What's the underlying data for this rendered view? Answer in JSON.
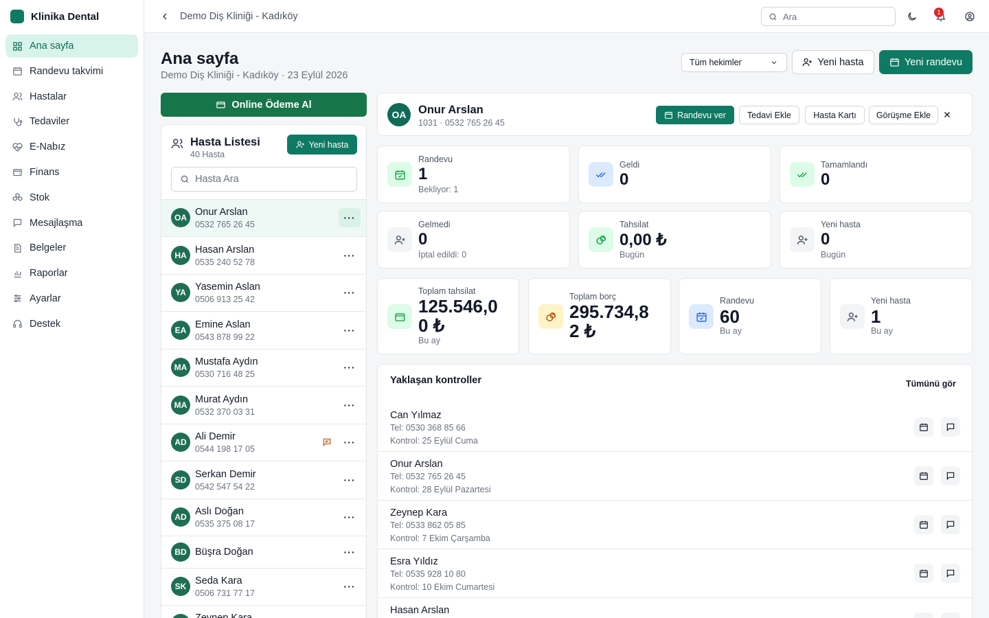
{
  "brand": {
    "name": "Klinika Dental",
    "color": "#0f7a63"
  },
  "nav": [
    {
      "label": "Ana sayfa",
      "icon": "dashboard-icon",
      "active": true
    },
    {
      "label": "Randevu takvimi",
      "icon": "calendar-icon"
    },
    {
      "label": "Hastalar",
      "icon": "users-icon"
    },
    {
      "label": "Tedaviler",
      "icon": "stethoscope-icon"
    },
    {
      "label": "E-Nabız",
      "icon": "heart-pulse-icon"
    },
    {
      "label": "Finans",
      "icon": "wallet-icon"
    },
    {
      "label": "Stok",
      "icon": "boxes-icon"
    },
    {
      "label": "Mesajlaşma",
      "icon": "message-icon"
    },
    {
      "label": "Belgeler",
      "icon": "document-icon"
    },
    {
      "label": "Raporlar",
      "icon": "bar-chart-icon"
    },
    {
      "label": "Ayarlar",
      "icon": "sliders-icon"
    },
    {
      "label": "Destek",
      "icon": "headset-icon"
    }
  ],
  "topbar": {
    "clinic": "Demo Diş Kliniği - Kadıköy",
    "search_placeholder": "Ara",
    "notification_count": "1"
  },
  "header": {
    "title": "Ana sayfa",
    "subtitle": "Demo Diş Kliniği - Kadıköy · 23 Eylül 2026",
    "doctor_filter": "Tüm hekimler",
    "new_patient": "Yeni hasta",
    "new_appointment": "Yeni randevu"
  },
  "online_payment": "Online Ödeme Al",
  "patient_list": {
    "title": "Hasta Listesi",
    "count": "40 Hasta",
    "add": "Yeni hasta",
    "search_placeholder": "Hasta Ara",
    "patients": [
      {
        "initials": "OA",
        "name": "Onur Arslan",
        "phone": "0532 765 26 45",
        "selected": true
      },
      {
        "initials": "HA",
        "name": "Hasan Arslan",
        "phone": "0535 240 52 78"
      },
      {
        "initials": "YA",
        "name": "Yasemin Aslan",
        "phone": "0506 913 25 42"
      },
      {
        "initials": "EA",
        "name": "Emine Aslan",
        "phone": "0543 878 99 22"
      },
      {
        "initials": "MA",
        "name": "Mustafa Aydın",
        "phone": "0530 716 48 25"
      },
      {
        "initials": "MA",
        "name": "Murat Aydın",
        "phone": "0532 370 03 31"
      },
      {
        "initials": "AD",
        "name": "Ali Demir",
        "phone": "0544 198 17 05",
        "has_message": true
      },
      {
        "initials": "SD",
        "name": "Serkan Demir",
        "phone": "0542 547 54 22"
      },
      {
        "initials": "AD",
        "name": "Aslı Doğan",
        "phone": "0535 375 08 17"
      },
      {
        "initials": "BD",
        "name": "Büşra Doğan",
        "phone": ""
      },
      {
        "initials": "SK",
        "name": "Seda Kara",
        "phone": "0506 731 77 17"
      },
      {
        "initials": "ZK",
        "name": "Zeynep Kara",
        "phone": ""
      }
    ]
  },
  "patient_header": {
    "initials": "OA",
    "name": "Onur Arslan",
    "info": "1031 · 0532 765 26 45",
    "buttons": [
      "Randevu ver",
      "Tedavi Ekle",
      "Hasta Kartı",
      "Görüşme Ekle"
    ]
  },
  "patient_stats": [
    {
      "label": "Randevu",
      "value": "1",
      "sub": "Bekliyor: 1",
      "icon": "calendar-check-icon",
      "tone": "green"
    },
    {
      "label": "Geldi",
      "value": "0",
      "sub": "",
      "icon": "double-check-icon",
      "tone": "blue"
    },
    {
      "label": "Tamamlandı",
      "value": "0",
      "sub": "",
      "icon": "double-check-icon",
      "tone": "green"
    },
    {
      "label": "Gelmedi",
      "value": "0",
      "sub": "İptal edildi: 0",
      "icon": "user-x-icon",
      "tone": "gray"
    },
    {
      "label": "Tahsilat",
      "value": "0,00 ₺",
      "sub": "Bugün",
      "icon": "coins-icon",
      "tone": "green"
    },
    {
      "label": "Yeni hasta",
      "value": "0",
      "sub": "Bugün",
      "icon": "user-plus-icon",
      "tone": "gray"
    }
  ],
  "summary_stats": [
    {
      "label": "Toplam tahsilat",
      "value": "125.546,00 ₺",
      "sub": "Bu ay",
      "icon": "wallet-icon",
      "tone": "green"
    },
    {
      "label": "Toplam borç",
      "value": "295.734,82 ₺",
      "sub": "",
      "icon": "coins-icon",
      "tone": "yellow"
    },
    {
      "label": "Randevu",
      "value": "60",
      "sub": "Bu ay",
      "icon": "calendar-check-icon",
      "tone": "blue"
    },
    {
      "label": "Yeni hasta",
      "value": "1",
      "sub": "Bu ay",
      "icon": "user-plus-icon",
      "tone": "gray"
    }
  ],
  "upcoming": {
    "title": "Yaklaşan kontroller",
    "see_all": "Tümünü gör",
    "items": [
      {
        "name": "Can Yılmaz",
        "tel": "Tel: 0530 368 85 66",
        "kontrol": "Kontrol: 25 Eylül Cuma"
      },
      {
        "name": "Onur Arslan",
        "tel": "Tel: 0532 765 26 45",
        "kontrol": "Kontrol: 28 Eylül Pazartesi"
      },
      {
        "name": "Zeynep Kara",
        "tel": "Tel: 0533 862 05 85",
        "kontrol": "Kontrol: 7 Ekim Çarşamba"
      },
      {
        "name": "Esra Yıldız",
        "tel": "Tel: 0535 928 10 80",
        "kontrol": "Kontrol: 10 Ekim Cumartesi"
      },
      {
        "name": "Hasan Arslan",
        "tel": "",
        "kontrol": ""
      }
    ]
  }
}
